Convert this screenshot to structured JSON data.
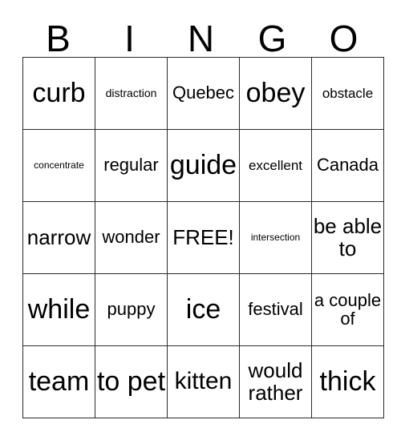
{
  "card": {
    "header_letters": [
      "B",
      "I",
      "N",
      "G",
      "O"
    ],
    "free_space_label": "FREE!",
    "grid_size": 5,
    "border_color": "#2b2b2b",
    "background_color": "#ffffff",
    "text_color": "#000000",
    "rows": [
      {
        "cells": [
          {
            "text": "curb",
            "size": "fs-xxl",
            "lines": 1
          },
          {
            "text": "distraction",
            "size": "fs-xs",
            "lines": 1
          },
          {
            "text": "Quebec",
            "size": "fs-md",
            "lines": 1
          },
          {
            "text": "obey",
            "size": "fs-xxl",
            "lines": 1
          },
          {
            "text": "obstacle",
            "size": "fs-sm",
            "lines": 1
          }
        ]
      },
      {
        "cells": [
          {
            "text": "concentrate",
            "size": "fs-xxs",
            "lines": 1
          },
          {
            "text": "regular",
            "size": "fs-md",
            "lines": 1
          },
          {
            "text": "guide",
            "size": "fs-xxl",
            "lines": 1
          },
          {
            "text": "excellent",
            "size": "fs-sm",
            "lines": 1
          },
          {
            "text": "Canada",
            "size": "fs-md",
            "lines": 1
          }
        ]
      },
      {
        "cells": [
          {
            "text": "narrow",
            "size": "fs-lg",
            "lines": 1
          },
          {
            "text": "wonder",
            "size": "fs-md",
            "lines": 1
          },
          {
            "text": "FREE!",
            "size": "fs-lg",
            "lines": 1
          },
          {
            "text": "intersection",
            "size": "fs-xxs",
            "lines": 1
          },
          {
            "text": "be able to",
            "size": "fs-lg",
            "lines": 2
          }
        ]
      },
      {
        "cells": [
          {
            "text": "while",
            "size": "fs-xxl",
            "lines": 1
          },
          {
            "text": "puppy",
            "size": "fs-md",
            "lines": 1
          },
          {
            "text": "ice",
            "size": "fs-xxl",
            "lines": 1
          },
          {
            "text": "festival",
            "size": "fs-md",
            "lines": 1
          },
          {
            "text": "a couple of",
            "size": "fs-md",
            "lines": 3
          }
        ]
      },
      {
        "cells": [
          {
            "text": "team",
            "size": "fs-xxl",
            "lines": 1
          },
          {
            "text": "to pet",
            "size": "fs-xxl",
            "lines": 2
          },
          {
            "text": "kitten",
            "size": "fs-xl",
            "lines": 1
          },
          {
            "text": "would rather",
            "size": "fs-lg",
            "lines": 2
          },
          {
            "text": "thick",
            "size": "fs-xxl",
            "lines": 1
          }
        ]
      }
    ]
  }
}
